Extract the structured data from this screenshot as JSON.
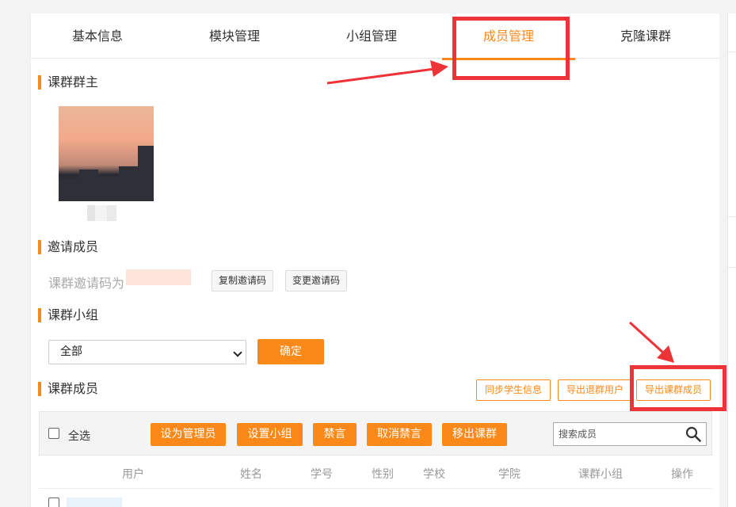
{
  "tabs": [
    {
      "label": "基本信息",
      "active": false
    },
    {
      "label": "模块管理",
      "active": false
    },
    {
      "label": "小组管理",
      "active": false
    },
    {
      "label": "成员管理",
      "active": true
    },
    {
      "label": "克隆课群",
      "active": false
    }
  ],
  "sections": {
    "owner_title": "课群群主",
    "invite_title": "邀请成员",
    "group_title": "课群小组",
    "members_title": "课群成员"
  },
  "invite": {
    "label": "课群邀请码为",
    "copy_button": "复制邀请码",
    "change_button": "变更邀请码"
  },
  "group_filter": {
    "selected": "全部",
    "confirm_button": "确定"
  },
  "member_actions": {
    "sync_button": "同步学生信息",
    "export_quit_button": "导出退群用户",
    "export_members_button": "导出课群成员"
  },
  "toolbar": {
    "select_all": "全选",
    "buttons": [
      "设为管理员",
      "设置小组",
      "禁言",
      "取消禁言",
      "移出课群"
    ],
    "search_placeholder": "搜索成员"
  },
  "table": {
    "headers": [
      "用户",
      "姓名",
      "学号",
      "性别",
      "学校",
      "学院",
      "课群小组",
      "操作"
    ]
  },
  "colors": {
    "accent": "#fa8919",
    "annotation": "#ee3338"
  }
}
